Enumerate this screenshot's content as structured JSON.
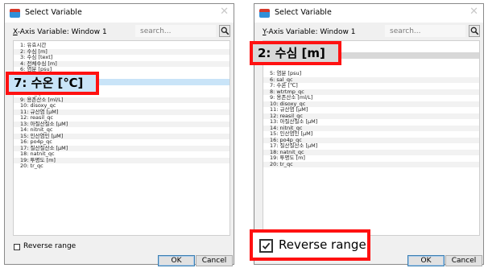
{
  "left_dialog": {
    "title": "Select Variable",
    "axis_prefix": "X",
    "axis_rest": "-Axis Variable: Window 1",
    "search_placeholder": "search...",
    "items": [
      "1: 유효시간",
      "2: 수심 [m]",
      "3: 수심 [text]",
      "4: 전체수심 [m]",
      "6: 염분 [psu]",
      "7: 수온 [℃]",
      "8: sal_qc",
      "9: 용존산소 [ml/L]",
      "10: disoxy_qc",
      "11: 규산염 [μM]",
      "12: reasil_qc",
      "13: 아질산질소 [μM]",
      "14: nitnit_qc",
      "15: 인산염인 [μM]",
      "16: po4p_qc",
      "17: 질산질산소 [μM]",
      "18: natnit_qc",
      "19: 투명도 [m]",
      "20: tr_qc"
    ],
    "selected_callout": "7: 수온 [℃]",
    "reverse_label": "Reverse range",
    "reverse_checked": false,
    "ok_label": "OK",
    "cancel_label": "Cancel"
  },
  "right_dialog": {
    "title": "Select Variable",
    "axis_prefix": "Y",
    "axis_rest": "-Axis Variable: Window 1",
    "search_placeholder": "search...",
    "items": [
      "5: 염분 [psu]",
      "6: sal_qc",
      "7: 수온 [℃]",
      "8: wtrtmp_qc",
      "9: 용존산소 [ml/L]",
      "10: disoxy_qc",
      "11: 규산염 [μM]",
      "12: reasil_qc",
      "13: 아질산질소 [μM]",
      "14: nitnit_qc",
      "15: 인산염인 [μM]",
      "16: po4p_qc",
      "17: 질산질산소 [μM]",
      "18: natnit_qc",
      "19: 투명도 [m]",
      "20: tr_qc"
    ],
    "selected_callout": "2: 수심 [m]",
    "reverse_label": "Reverse range",
    "reverse_checked": true,
    "ok_label": "OK",
    "cancel_label": "Cancel"
  },
  "colors": {
    "callout_border": "#ff1111",
    "selection_blue": "#c9e4f8",
    "selection_grey": "#d8d8d8"
  }
}
